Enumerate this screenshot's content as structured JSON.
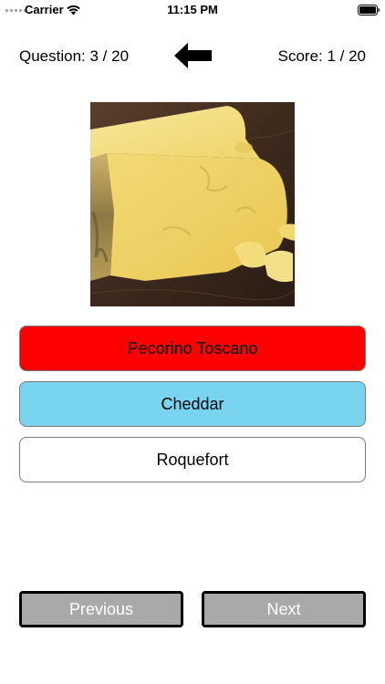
{
  "status_bar": {
    "carrier": "Carrier",
    "time": "11:15 PM",
    "wifi_icon": "wifi-icon",
    "battery_icon": "battery-icon"
  },
  "header": {
    "question_counter": "Question: 3 / 20",
    "score_counter": "Score: 1 / 20",
    "back_icon": "arrow-left-icon"
  },
  "question": {
    "image": "cheese wedge photo"
  },
  "answers": [
    {
      "label": "Pecorino Toscano",
      "color": "#ff0000",
      "state": "wrong"
    },
    {
      "label": "Cheddar",
      "color": "#78d4ef",
      "state": "correct"
    },
    {
      "label": "Roquefort",
      "color": "#ffffff",
      "state": "neutral"
    }
  ],
  "navigation": {
    "previous_label": "Previous",
    "next_label": "Next",
    "button_color": "#a9a9a9"
  }
}
